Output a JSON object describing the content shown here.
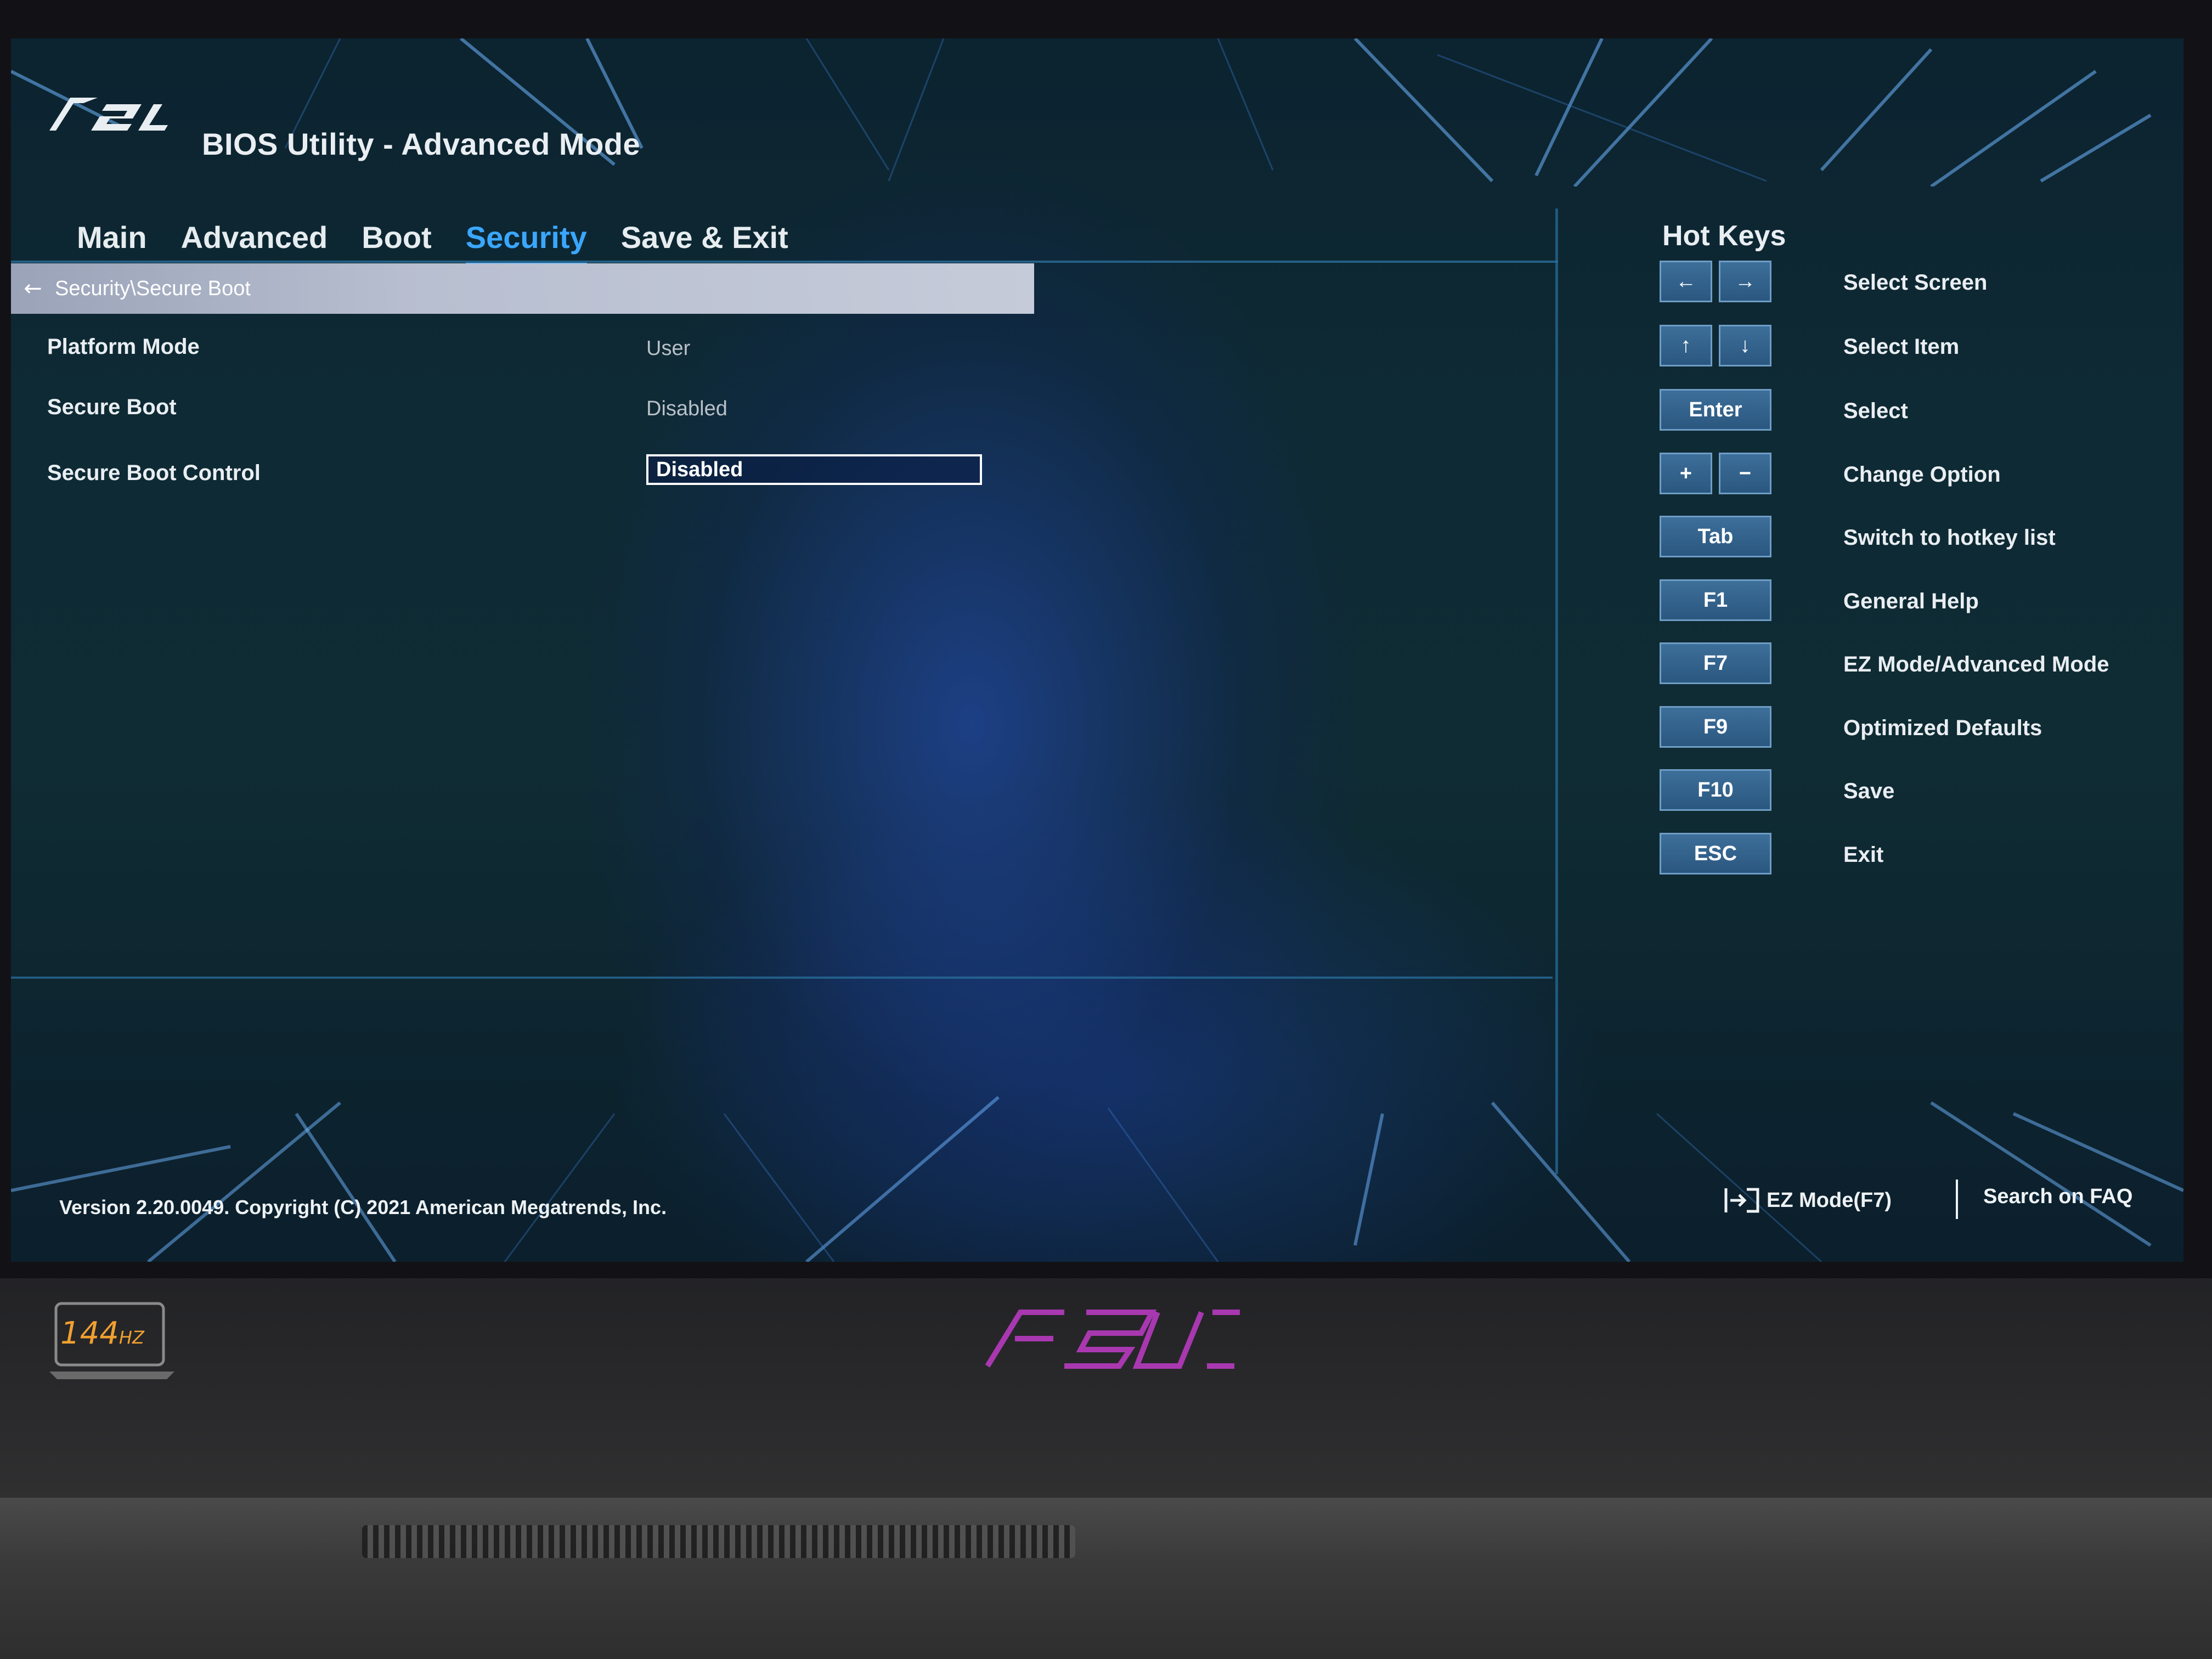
{
  "app": {
    "brand": "ASUS",
    "title": "BIOS Utility - Advanced Mode"
  },
  "tabs": [
    {
      "label": "Main",
      "active": false
    },
    {
      "label": "Advanced",
      "active": false
    },
    {
      "label": "Boot",
      "active": false
    },
    {
      "label": "Security",
      "active": true
    },
    {
      "label": "Save & Exit",
      "active": false
    }
  ],
  "breadcrumb": {
    "back_icon": "arrow-left-icon",
    "path": "Security\\Secure Boot"
  },
  "settings": [
    {
      "label": "Platform Mode",
      "value": "User",
      "editable": false
    },
    {
      "label": "Secure Boot",
      "value": "Disabled",
      "editable": false
    },
    {
      "label": "Secure Boot Control",
      "value": "Disabled",
      "editable": true
    }
  ],
  "hotkeys": {
    "title": "Hot Keys",
    "items": [
      {
        "keys": [
          "←",
          "→"
        ],
        "description": "Select Screen"
      },
      {
        "keys": [
          "↑",
          "↓"
        ],
        "description": "Select Item"
      },
      {
        "keys": [
          "Enter"
        ],
        "description": "Select"
      },
      {
        "keys": [
          "+",
          "−"
        ],
        "description": "Change Option"
      },
      {
        "keys": [
          "Tab"
        ],
        "description": "Switch to hotkey list"
      },
      {
        "keys": [
          "F1"
        ],
        "description": "General Help"
      },
      {
        "keys": [
          "F7"
        ],
        "description": "EZ Mode/Advanced Mode"
      },
      {
        "keys": [
          "F9"
        ],
        "description": "Optimized Defaults"
      },
      {
        "keys": [
          "F10"
        ],
        "description": "Save"
      },
      {
        "keys": [
          "ESC"
        ],
        "description": "Exit"
      }
    ]
  },
  "footer": {
    "version": "Version 2.20.0049. Copyright (C) 2021 American Megatrends, Inc.",
    "ez_mode": "EZ Mode(F7)",
    "ez_mode_icon": "enter-mode-icon",
    "search_faq": "Search on FAQ"
  },
  "chassis": {
    "refresh_rate": "144",
    "refresh_unit": "HZ",
    "logo": "ASUS"
  },
  "colors": {
    "accent": "#3aa7ff",
    "key_fill": "#2f5f8a",
    "text": "#e9eef2",
    "refresh_badge": "#f0a030",
    "chassis_logo": "#c03cc8"
  }
}
